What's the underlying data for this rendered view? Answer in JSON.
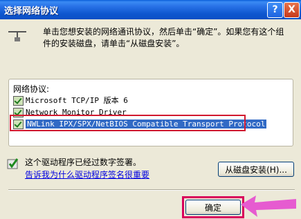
{
  "window": {
    "title": "选择网络协议",
    "help_label": "?",
    "close_label": "X"
  },
  "instruction": {
    "line1": "单击您想安装的网络通讯协议，然后单击“确定”。如果您有这个组",
    "line2": "件的安装磁盘，请单击“从磁盘安装”。"
  },
  "protocol_list": {
    "label": "网络协议:",
    "items": [
      {
        "label": "Microsoft TCP/IP 版本 6",
        "selected": false
      },
      {
        "label": "Network Monitor Driver",
        "selected": false
      },
      {
        "label": "NWLink IPX/SPX/NetBIOS Compatible Transport Protocol",
        "selected": true
      }
    ]
  },
  "signature": {
    "text": "这个驱动程序已经过数字签署。",
    "link": "告诉我为什么驱动程序签名很重要"
  },
  "buttons": {
    "have_disk": "从磁盘安装(H)...",
    "ok": "确定"
  },
  "colors": {
    "titlebar": "#0a5fd9",
    "selection": "#316ac5",
    "highlight_red": "#d2182f",
    "arrow_magenta": "#d9005b"
  }
}
